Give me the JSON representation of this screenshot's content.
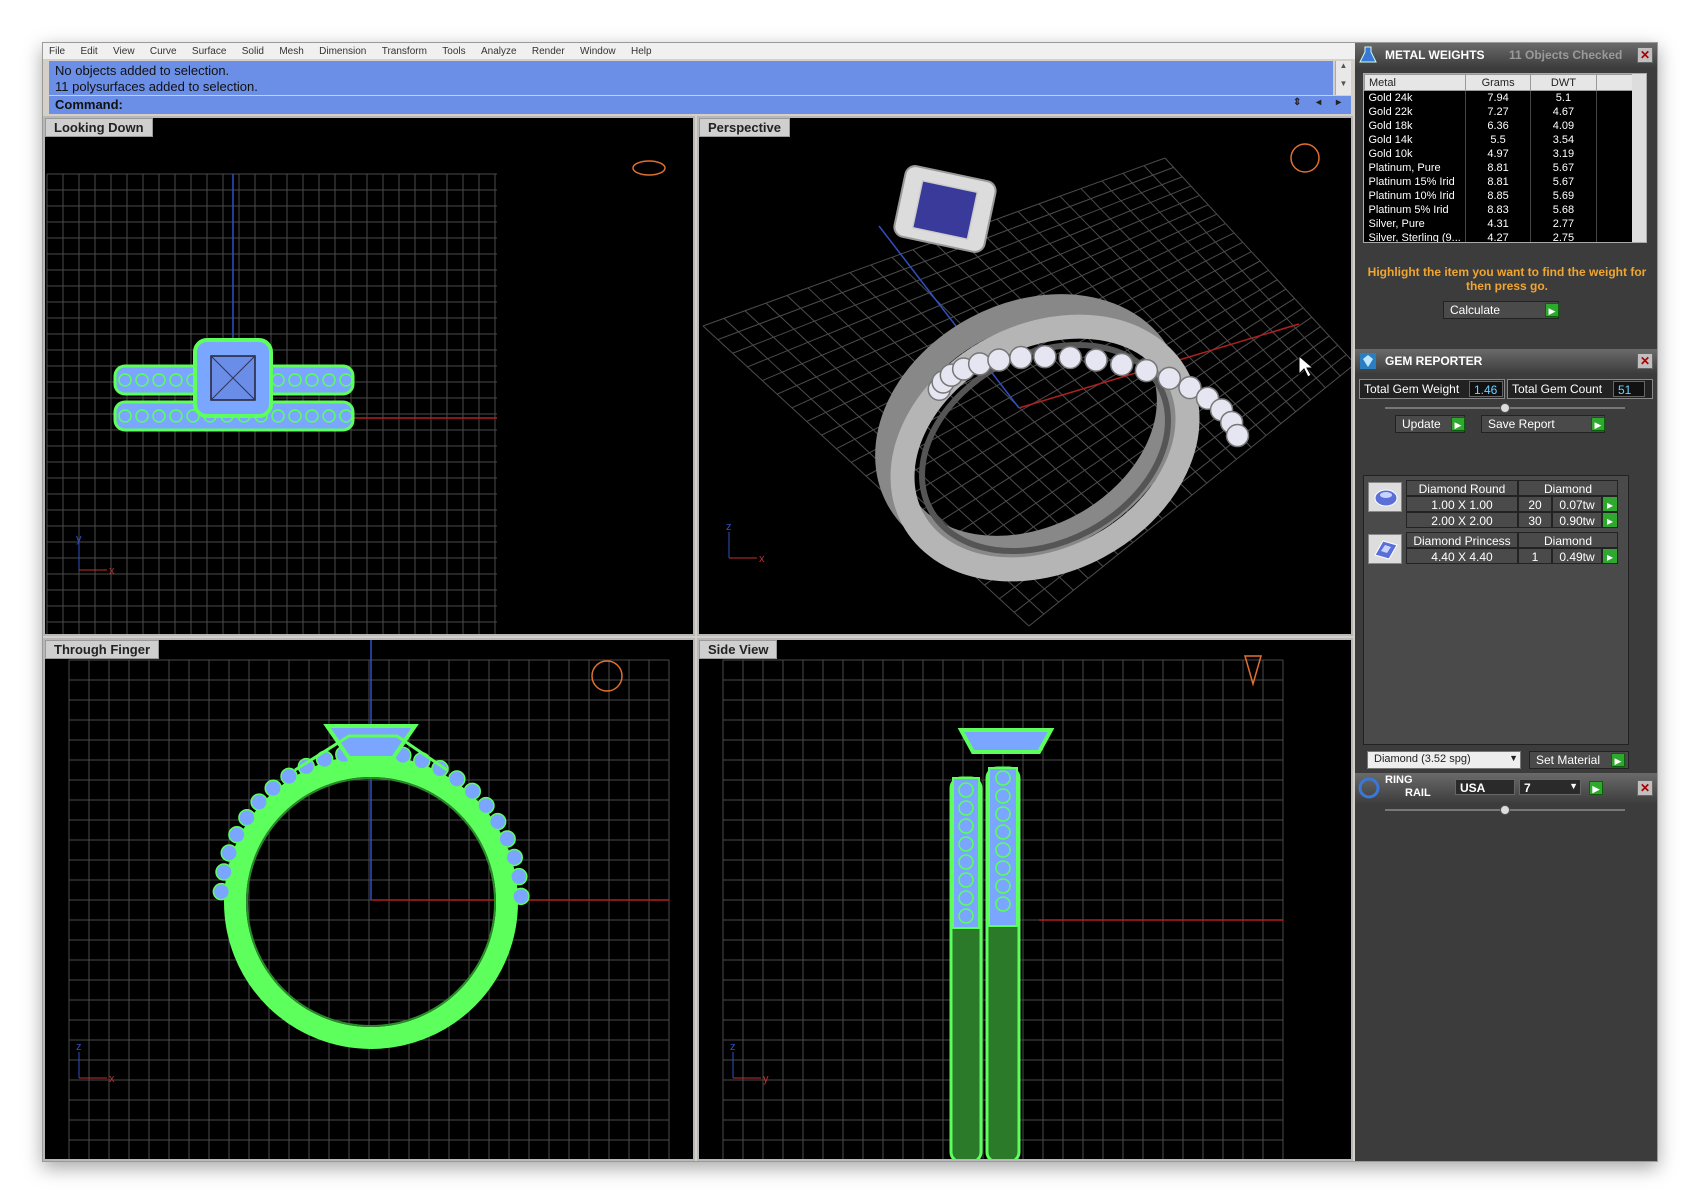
{
  "menu": [
    "File",
    "Edit",
    "View",
    "Curve",
    "Surface",
    "Solid",
    "Mesh",
    "Dimension",
    "Transform",
    "Tools",
    "Analyze",
    "Render",
    "Window",
    "Help"
  ],
  "command": {
    "history": [
      "No objects added to selection.",
      "11 polysurfaces added to selection."
    ],
    "prompt": "Command:"
  },
  "viewports": {
    "top": "Looking Down",
    "perspective": "Perspective",
    "front": "Through Finger",
    "right": "Side View",
    "axis_labels": {
      "x": "x",
      "y": "y",
      "z": "z"
    }
  },
  "metal_weights": {
    "title": "METAL WEIGHTS",
    "checked": "11 Objects Checked",
    "columns": [
      "Metal",
      "Grams",
      "DWT"
    ],
    "rows": [
      [
        "Gold 24k",
        "7.94",
        "5.1"
      ],
      [
        "Gold 22k",
        "7.27",
        "4.67"
      ],
      [
        "Gold 18k",
        "6.36",
        "4.09"
      ],
      [
        "Gold 14k",
        "5.5",
        "3.54"
      ],
      [
        "Gold 10k",
        "4.97",
        "3.19"
      ],
      [
        "Platinum, Pure",
        "8.81",
        "5.67"
      ],
      [
        "Platinum 15% Irid",
        "8.81",
        "5.67"
      ],
      [
        "Platinum 10% Irid",
        "8.85",
        "5.69"
      ],
      [
        "Platinum 5% Irid",
        "8.83",
        "5.68"
      ],
      [
        "Silver, Pure",
        "4.31",
        "2.77"
      ],
      [
        "Silver, Sterling (9...",
        "4.27",
        "2.75"
      ]
    ],
    "hint": "Highlight the item you want to find the weight for then press go.",
    "calculate_label": "Calculate"
  },
  "gem_reporter": {
    "title": "GEM REPORTER",
    "total_weight_label": "Total Gem Weight",
    "total_weight": "1.46",
    "total_count_label": "Total Gem Count",
    "total_count": "51",
    "update_label": "Update",
    "save_label": "Save Report",
    "groups": [
      {
        "shape": "Diamond Round",
        "material": "Diamond",
        "rows": [
          [
            "1.00 X 1.00",
            "20",
            "0.07tw"
          ],
          [
            "2.00 X 2.00",
            "30",
            "0.90tw"
          ]
        ]
      },
      {
        "shape": "Diamond Princess",
        "material": "Diamond",
        "rows": [
          [
            "4.40 X 4.40",
            "1",
            "0.49tw"
          ]
        ]
      }
    ],
    "material_select": "Diamond    (3.52 spg)",
    "set_material_label": "Set Material"
  },
  "ring_rail": {
    "title_line1": "RING",
    "title_line2": "RAIL",
    "standard": "USA",
    "size": "7"
  },
  "colors": {
    "wire_green": "#5cff5c",
    "gem_blue": "#7aa6ff",
    "command_blue": "#6b8fe6",
    "hint_orange": "#f0a630"
  }
}
